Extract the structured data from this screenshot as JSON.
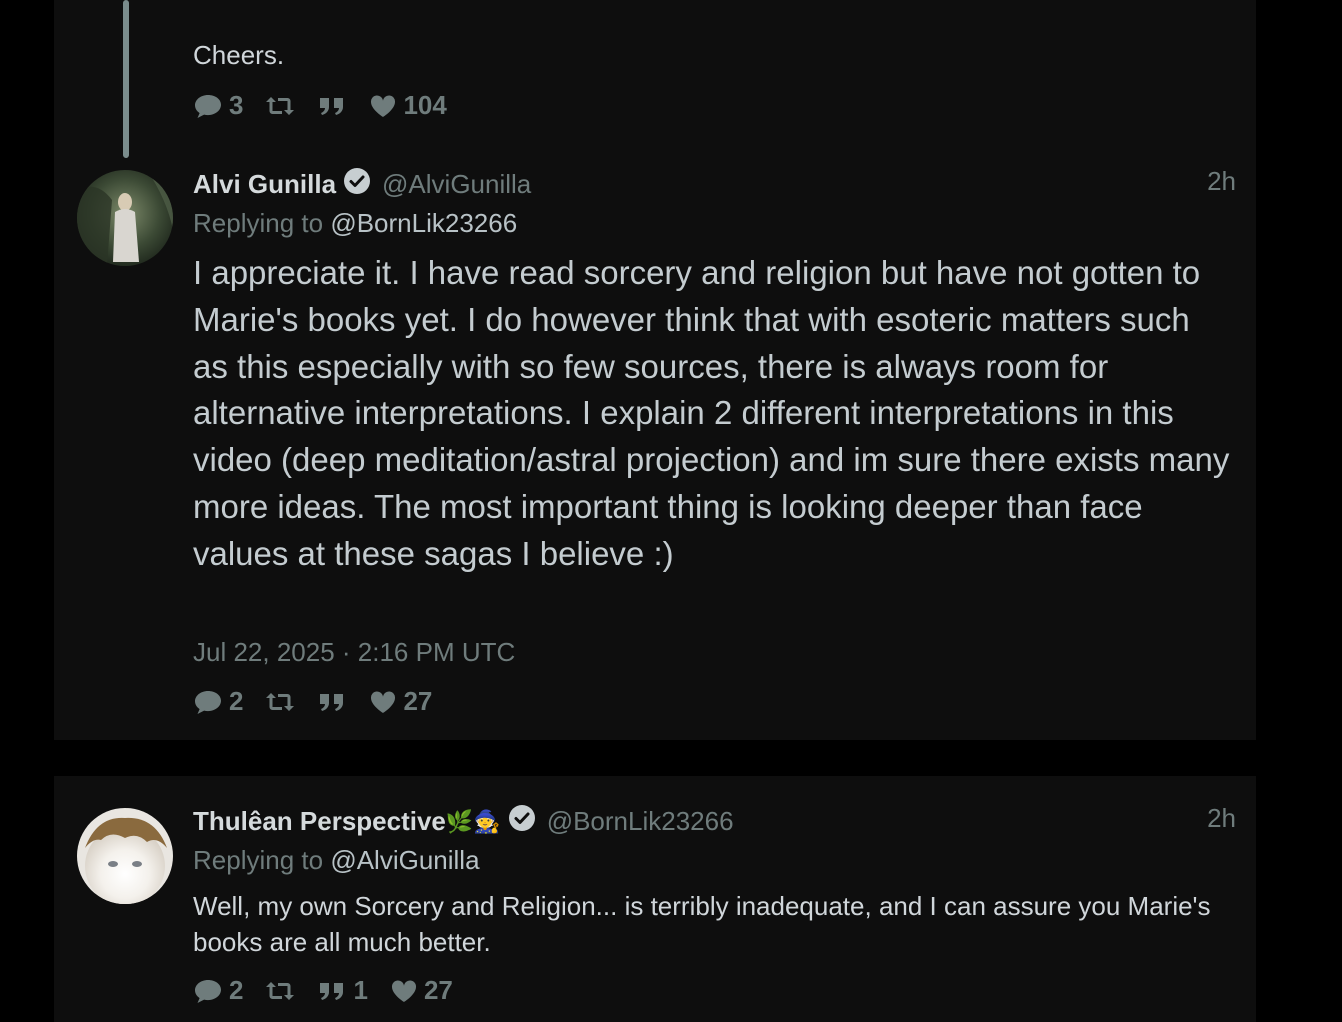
{
  "top_tweet": {
    "text": "Cheers.",
    "stats": {
      "replies": "3",
      "retweets": "",
      "quotes": "",
      "likes": "104"
    }
  },
  "main_tweet": {
    "name": "Alvi Gunilla",
    "handle": "@AlviGunilla",
    "time": "2h",
    "replying_prefix": "Replying to",
    "replying_to": "@BornLik23266",
    "body": "I appreciate it. I have read sorcery and religion but have not gotten to Marie's books yet. I do however think that with esoteric matters such as this especially with so few sources, there is always room for alternative interpretations. I explain 2 different interpretations in this video (deep meditation/astral projection) and im sure there exists many more ideas. The most important thing is looking deeper than face values at these sagas I believe :)",
    "date": "Jul 22, 2025 · 2:16 PM UTC",
    "stats": {
      "replies": "2",
      "retweets": "",
      "quotes": "",
      "likes": "27"
    }
  },
  "reply_tweet": {
    "name": "Thulêan Perspective",
    "name_emoji": "🌿🧙",
    "handle": "@BornLik23266",
    "time": "2h",
    "replying_prefix": "Replying to",
    "replying_to": "@AlviGunilla",
    "body": "Well, my own Sorcery and Religion... is terribly inadequate, and I can assure you Marie's books are all much better.",
    "stats": {
      "replies": "2",
      "retweets": "",
      "quotes": "1",
      "likes": "27"
    }
  },
  "icons": {
    "reply": "comment-bubble-icon",
    "retweet": "retweet-icon",
    "quote": "quote-icon",
    "like": "heart-icon",
    "verified": "verified-badge-icon"
  },
  "colors": {
    "background": "#000000",
    "card": "#0e0e0e",
    "muted": "#6f7c7c",
    "text": "#c4ccd0"
  }
}
